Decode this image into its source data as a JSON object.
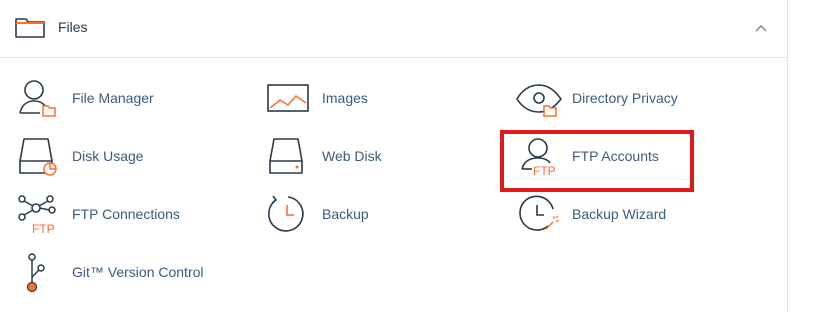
{
  "section": {
    "title": "Files",
    "icon": "folder-icon",
    "collapse_icon": "chevron-up-icon"
  },
  "items": [
    {
      "label": "File Manager",
      "icon": "file-manager-icon"
    },
    {
      "label": "Images",
      "icon": "images-icon"
    },
    {
      "label": "Directory Privacy",
      "icon": "eye-folder-icon"
    },
    {
      "label": "Disk Usage",
      "icon": "disk-usage-icon"
    },
    {
      "label": "Web Disk",
      "icon": "web-disk-icon"
    },
    {
      "label": "FTP Accounts",
      "icon": "ftp-user-icon",
      "icon_text": "FTP"
    },
    {
      "label": "FTP Connections",
      "icon": "ftp-network-icon",
      "icon_text": "FTP"
    },
    {
      "label": "Backup",
      "icon": "clock-backup-icon"
    },
    {
      "label": "Backup Wizard",
      "icon": "clock-wand-icon"
    },
    {
      "label": "Git™ Version Control",
      "icon": "git-branch-icon"
    }
  ],
  "colors": {
    "accent": "#ff6c2c",
    "icon_stroke": "#293a4a",
    "link": "#3b5a7f",
    "highlight_box": "#e01818"
  }
}
